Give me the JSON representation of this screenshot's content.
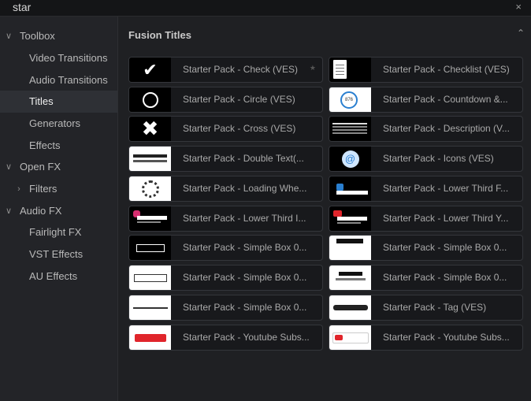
{
  "search": {
    "query": "star",
    "close_glyph": "×"
  },
  "sidebar": {
    "items": [
      {
        "label": "Toolbox",
        "level": 0,
        "chevron": "expanded",
        "selected": false
      },
      {
        "label": "Video Transitions",
        "level": 1,
        "chevron": "none",
        "selected": false
      },
      {
        "label": "Audio Transitions",
        "level": 1,
        "chevron": "none",
        "selected": false
      },
      {
        "label": "Titles",
        "level": 1,
        "chevron": "none",
        "selected": true
      },
      {
        "label": "Generators",
        "level": 1,
        "chevron": "none",
        "selected": false
      },
      {
        "label": "Effects",
        "level": 1,
        "chevron": "none",
        "selected": false
      },
      {
        "label": "Open FX",
        "level": 0,
        "chevron": "expanded",
        "selected": false
      },
      {
        "label": "Filters",
        "level": 1,
        "chevron": "collapsed",
        "selected": false
      },
      {
        "label": "Audio FX",
        "level": 0,
        "chevron": "expanded",
        "selected": false
      },
      {
        "label": "Fairlight FX",
        "level": 1,
        "chevron": "none",
        "selected": false
      },
      {
        "label": "VST Effects",
        "level": 1,
        "chevron": "none",
        "selected": false
      },
      {
        "label": "AU Effects",
        "level": 1,
        "chevron": "none",
        "selected": false
      }
    ]
  },
  "main": {
    "section_title": "Fusion Titles",
    "tiles": [
      {
        "label": "Starter Pack - Check (VES)",
        "thumb": "check-icon"
      },
      {
        "label": "Starter Pack - Checklist (VES)",
        "thumb": "checklist-icon"
      },
      {
        "label": "Starter Pack - Circle (VES)",
        "thumb": "circle-icon"
      },
      {
        "label": "Starter Pack - Countdown &...",
        "thumb": "countdown-icon"
      },
      {
        "label": "Starter Pack - Cross (VES)",
        "thumb": "cross-icon"
      },
      {
        "label": "Starter Pack - Description (V...",
        "thumb": "description-icon"
      },
      {
        "label": "Starter Pack - Double Text(...",
        "thumb": "double-text-icon"
      },
      {
        "label": "Starter Pack - Icons (VES)",
        "thumb": "icons-icon"
      },
      {
        "label": "Starter Pack - Loading Whe...",
        "thumb": "loading-wheel-icon"
      },
      {
        "label": "Starter Pack - Lower Third F...",
        "thumb": "lower-third-facebook-icon"
      },
      {
        "label": "Starter Pack - Lower Third I...",
        "thumb": "lower-third-instagram-icon"
      },
      {
        "label": "Starter Pack - Lower Third Y...",
        "thumb": "lower-third-youtube-icon"
      },
      {
        "label": "Starter Pack - Simple Box 0...",
        "thumb": "simple-box-dark-icon"
      },
      {
        "label": "Starter Pack - Simple Box 0...",
        "thumb": "simple-box-light-icon"
      },
      {
        "label": "Starter Pack - Simple Box 0...",
        "thumb": "simple-box-spaced-icon"
      },
      {
        "label": "Starter Pack - Simple Box 0...",
        "thumb": "simple-box-modern-icon"
      },
      {
        "label": "Starter Pack - Simple Box 0...",
        "thumb": "simple-box-line-icon"
      },
      {
        "label": "Starter Pack - Tag (VES)",
        "thumb": "tag-icon"
      },
      {
        "label": "Starter Pack - Youtube Subs...",
        "thumb": "youtube-subscribe-icon"
      },
      {
        "label": "Starter Pack - Youtube Subs...",
        "thumb": "youtube-subscribed-icon"
      }
    ]
  },
  "colors": {
    "panel": "#1e1f22",
    "sidebar": "#232428",
    "selected": "#2e3035",
    "tile": "#18191c",
    "text": "#a9a9a9",
    "youtube_red": "#e0252b",
    "accent_blue": "#2a7fd0"
  }
}
